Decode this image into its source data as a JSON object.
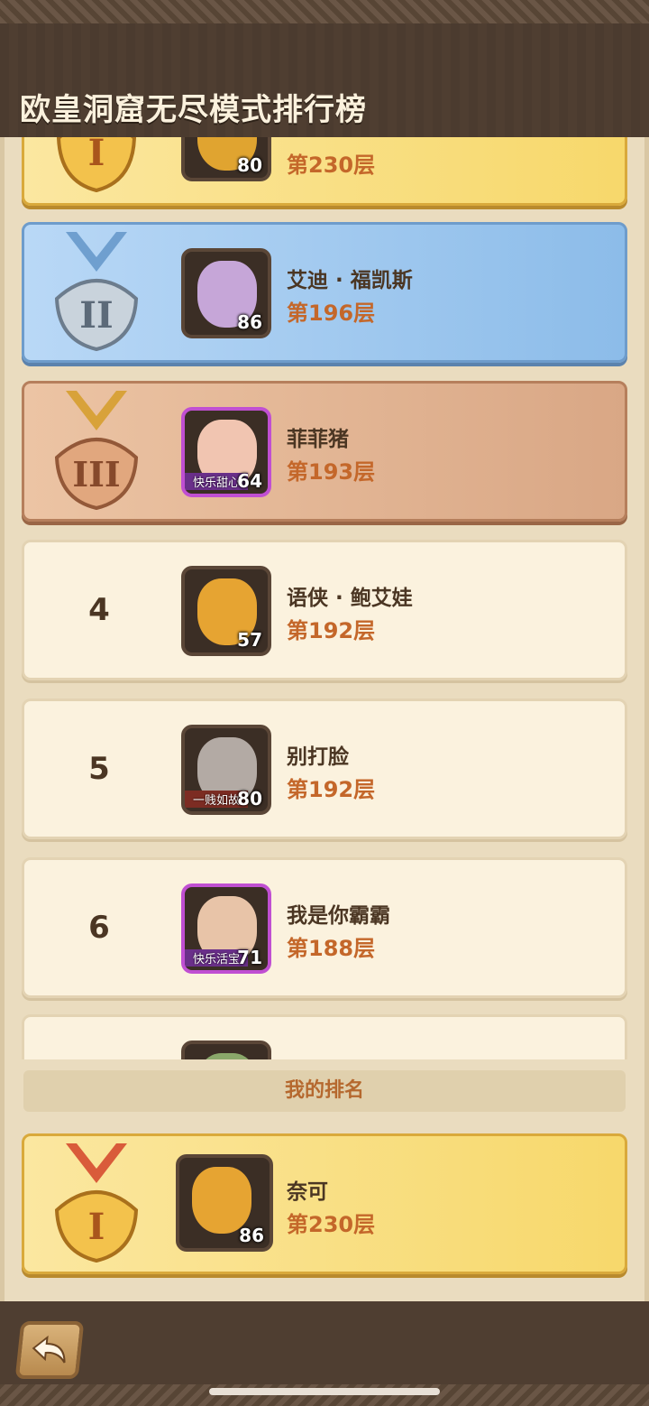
{
  "header": {
    "title": "欧皇洞窟无尽模式排行榜"
  },
  "list": [
    {
      "rank": "1",
      "name": "",
      "floor": "第230层",
      "level": "80",
      "style": "gold"
    },
    {
      "rank": "2",
      "name": "艾迪 · 福凯斯",
      "floor": "第196层",
      "level": "86",
      "style": "silver"
    },
    {
      "rank": "3",
      "name": "菲菲猪",
      "floor": "第193层",
      "level": "64",
      "tag": "快乐甜心",
      "style": "bronze"
    },
    {
      "rank": "4",
      "name": "语侠 · 鲍艾娃",
      "floor": "第192层",
      "level": "57",
      "style": "plain"
    },
    {
      "rank": "5",
      "name": "别打脸",
      "floor": "第192层",
      "level": "80",
      "tag": "一贱如故",
      "style": "plain"
    },
    {
      "rank": "6",
      "name": "我是你霸霸",
      "floor": "第188层",
      "level": "71",
      "tag": "快乐活宝",
      "style": "plain"
    }
  ],
  "my_rank": {
    "label": "我的排名",
    "name": "奈可",
    "floor": "第230层",
    "level": "86"
  },
  "colors": {
    "floor_text": "#c4672a",
    "name_text": "#4b3623",
    "gold": "#f7d86b",
    "silver": "#8cbce9",
    "bronze": "#d9a785"
  },
  "icons": {
    "back": "back-arrow-icon",
    "medal_1": "gold-medal-icon",
    "medal_2": "silver-medal-icon",
    "medal_3": "bronze-medal-icon"
  }
}
